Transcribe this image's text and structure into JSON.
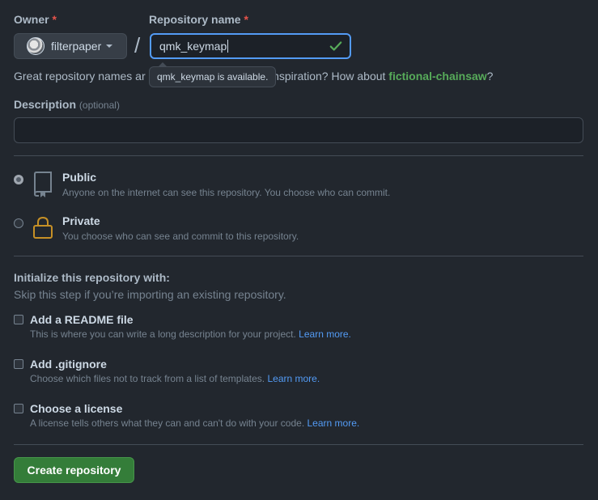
{
  "owner": {
    "label": "Owner",
    "required_mark": "*",
    "value": "filterpaper"
  },
  "repo_name": {
    "label": "Repository name",
    "required_mark": "*",
    "value": "qmk_keymap",
    "separator": "/"
  },
  "tooltip": "qmk_keymap is available.",
  "hint": {
    "prefix": "Great repository names ar",
    "middle": "Need inspiration? How about ",
    "suggestion": "fictional-chainsaw",
    "suffix": "?"
  },
  "description": {
    "label": "Description",
    "optional": "(optional)",
    "value": ""
  },
  "visibility": [
    {
      "title": "Public",
      "subtitle": "Anyone on the internet can see this repository. You choose who can commit.",
      "selected": true
    },
    {
      "title": "Private",
      "subtitle": "You choose who can see and commit to this repository.",
      "selected": false
    }
  ],
  "init": {
    "heading": "Initialize this repository with:",
    "subheading": "Skip this step if you’re importing an existing repository.",
    "options": [
      {
        "title": "Add a README file",
        "subtitle": "This is where you can write a long description for your project.",
        "link": "Learn more."
      },
      {
        "title": "Add .gitignore",
        "subtitle": "Choose which files not to track from a list of templates.",
        "link": "Learn more."
      },
      {
        "title": "Choose a license",
        "subtitle": "A license tells others what they can and can't do with your code.",
        "link": "Learn more."
      }
    ]
  },
  "create_button": "Create repository",
  "colors": {
    "background": "#22272e",
    "accent_green": "#57ab5a",
    "link_blue": "#539bf5",
    "button_green": "#347d39",
    "required_red": "#e5534b"
  }
}
